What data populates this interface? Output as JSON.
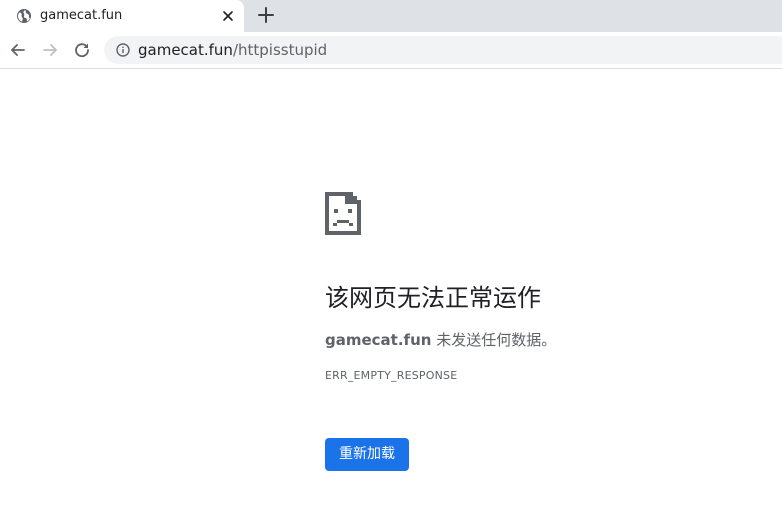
{
  "tab": {
    "title": "gamecat.fun",
    "favicon_icon": "globe-icon",
    "close_icon": "close-icon"
  },
  "new_tab_icon": "plus-icon",
  "toolbar": {
    "back_icon": "arrow-left-icon",
    "forward_icon": "arrow-right-icon",
    "reload_icon": "reload-icon",
    "site_info_icon": "info-icon"
  },
  "omnibox": {
    "host": "gamecat.fun",
    "path": "/httpisstupid"
  },
  "error": {
    "icon": "sad-page-icon",
    "title": "该网页无法正常运作",
    "host": "gamecat.fun",
    "message": " 未发送任何数据。",
    "code": "ERR_EMPTY_RESPONSE",
    "reload_label": "重新加载"
  },
  "colors": {
    "tabstrip_bg": "#dee1e6",
    "omnibox_bg": "#f1f3f4",
    "button_blue": "#1a73e8",
    "secondary_text": "#5f6368"
  }
}
